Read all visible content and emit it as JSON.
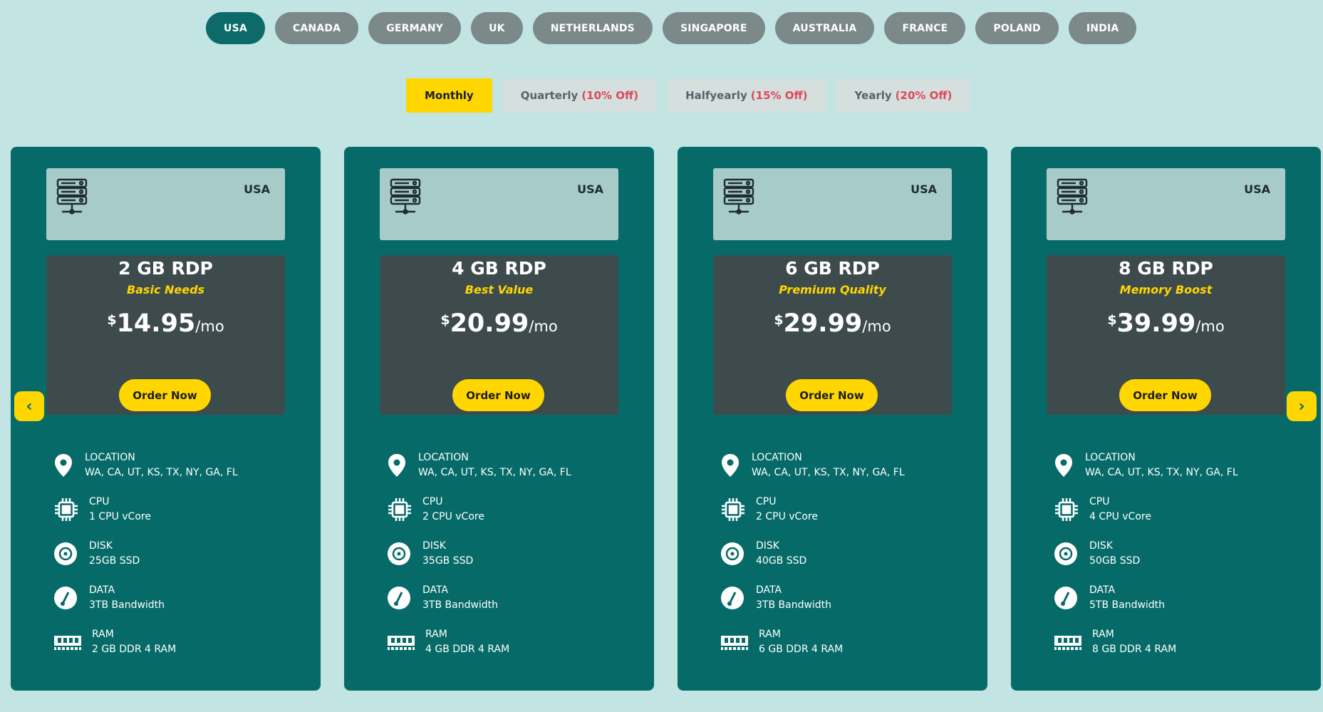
{
  "countries": [
    "USA",
    "CANADA",
    "GERMANY",
    "UK",
    "NETHERLANDS",
    "SINGAPORE",
    "AUSTRALIA",
    "FRANCE",
    "POLAND",
    "INDIA"
  ],
  "active_country": "USA",
  "billing": [
    {
      "label": "Monthly",
      "off": ""
    },
    {
      "label": "Quarterly",
      "off": "(10% Off)"
    },
    {
      "label": "Halfyearly",
      "off": "(15% Off)"
    },
    {
      "label": "Yearly",
      "off": "(20% Off)"
    }
  ],
  "colors": {
    "accent": "#ffd600",
    "card": "#066b68",
    "off_text": "#e0475a"
  },
  "cards": [
    {
      "country": "USA",
      "plan": "2 GB RDP",
      "tagline": "Basic Needs",
      "currency": "$",
      "price": "14.95",
      "period": "/mo",
      "order": "Order Now",
      "specs": [
        {
          "icon": "location-pin-icon",
          "label": "LOCATION",
          "value": "WA, CA, UT, KS, TX, NY, GA, FL"
        },
        {
          "icon": "cpu-chip-icon",
          "label": "CPU",
          "value": "1 CPU vCore"
        },
        {
          "icon": "disk-icon",
          "label": "DISK",
          "value": "25GB SSD"
        },
        {
          "icon": "gauge-icon",
          "label": "DATA",
          "value": "3TB Bandwidth"
        },
        {
          "icon": "ram-module-icon",
          "label": "RAM",
          "value": "2 GB DDR 4 RAM"
        }
      ]
    },
    {
      "country": "USA",
      "plan": "4 GB RDP",
      "tagline": "Best Value",
      "currency": "$",
      "price": "20.99",
      "period": "/mo",
      "order": "Order Now",
      "specs": [
        {
          "icon": "location-pin-icon",
          "label": "LOCATION",
          "value": "WA, CA, UT, KS, TX, NY, GA, FL"
        },
        {
          "icon": "cpu-chip-icon",
          "label": "CPU",
          "value": "2 CPU vCore"
        },
        {
          "icon": "disk-icon",
          "label": "DISK",
          "value": "35GB SSD"
        },
        {
          "icon": "gauge-icon",
          "label": "DATA",
          "value": "3TB Bandwidth"
        },
        {
          "icon": "ram-module-icon",
          "label": "RAM",
          "value": "4 GB DDR 4 RAM"
        }
      ]
    },
    {
      "country": "USA",
      "plan": "6 GB RDP",
      "tagline": "Premium Quality",
      "currency": "$",
      "price": "29.99",
      "period": "/mo",
      "order": "Order Now",
      "specs": [
        {
          "icon": "location-pin-icon",
          "label": "LOCATION",
          "value": "WA, CA, UT, KS, TX, NY, GA, FL"
        },
        {
          "icon": "cpu-chip-icon",
          "label": "CPU",
          "value": "2 CPU vCore"
        },
        {
          "icon": "disk-icon",
          "label": "DISK",
          "value": "40GB SSD"
        },
        {
          "icon": "gauge-icon",
          "label": "DATA",
          "value": "3TB Bandwidth"
        },
        {
          "icon": "ram-module-icon",
          "label": "RAM",
          "value": "6 GB DDR 4 RAM"
        }
      ]
    },
    {
      "country": "USA",
      "plan": "8 GB RDP",
      "tagline": "Memory Boost",
      "currency": "$",
      "price": "39.99",
      "period": "/mo",
      "order": "Order Now",
      "specs": [
        {
          "icon": "location-pin-icon",
          "label": "LOCATION",
          "value": "WA, CA, UT, KS, TX, NY, GA, FL"
        },
        {
          "icon": "cpu-chip-icon",
          "label": "CPU",
          "value": "4 CPU vCore"
        },
        {
          "icon": "disk-icon",
          "label": "DISK",
          "value": "50GB SSD"
        },
        {
          "icon": "gauge-icon",
          "label": "DATA",
          "value": "5TB Bandwidth"
        },
        {
          "icon": "ram-module-icon",
          "label": "RAM",
          "value": "8 GB DDR 4 RAM"
        }
      ]
    }
  ],
  "nav": {
    "prev_icon": "chevron-left-icon",
    "next_icon": "chevron-right-icon"
  }
}
